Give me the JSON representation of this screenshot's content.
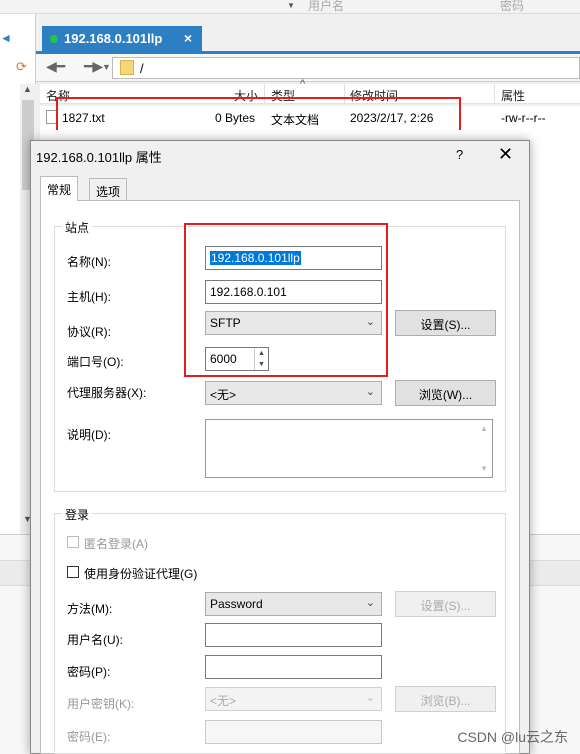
{
  "top_bar": {
    "username_placeholder": "用户名",
    "password_placeholder": "密码"
  },
  "tab": {
    "title": "192.168.0.101llp",
    "close": "×"
  },
  "address": {
    "path": "/"
  },
  "file_list": {
    "columns": {
      "name": "名称",
      "size": "大小",
      "type": "类型",
      "modified": "修改时间",
      "attrs": "属性"
    },
    "rows": [
      {
        "name": "1827.txt",
        "size": "0 Bytes",
        "type": "文本文档",
        "modified": "2023/2/17, 2:26",
        "attrs": "-rw-r--r--"
      }
    ]
  },
  "dialog": {
    "title": "192.168.0.101llp 属性",
    "help": "?",
    "close": "✕",
    "tabs": [
      "常规",
      "选项"
    ],
    "site_group": "站点",
    "name_label": "名称(N):",
    "name_value": "192.168.0.101llp",
    "host_label": "主机(H):",
    "host_value": "192.168.0.101",
    "protocol_label": "协议(R):",
    "protocol_value": "SFTP",
    "settings_button": "设置(S)...",
    "port_label": "端口号(O):",
    "port_value": "6000",
    "proxy_label": "代理服务器(X):",
    "proxy_value": "<无>",
    "browse_button": "浏览(W)...",
    "desc_label": "说明(D):",
    "desc_value": "",
    "login_group": "登录",
    "anonymous_label": "匿名登录(A)",
    "agent_label": "使用身份验证代理(G)",
    "method_label": "方法(M):",
    "method_value": "Password",
    "method_settings_button": "设置(S)...",
    "user_label": "用户名(U):",
    "user_value": "",
    "password_label": "密码(P):",
    "password_value": "",
    "userkey_label": "用户密钥(K):",
    "userkey_value": "<无>",
    "userkey_browse_button": "浏览(B)...",
    "passphrase_label": "密码(E):",
    "passphrase_value": ""
  },
  "watermark": "CSDN @lu云之东",
  "colors": {
    "tab_active": "#2c7fc2",
    "highlight": "#e02020",
    "selection": "#0078d7"
  }
}
